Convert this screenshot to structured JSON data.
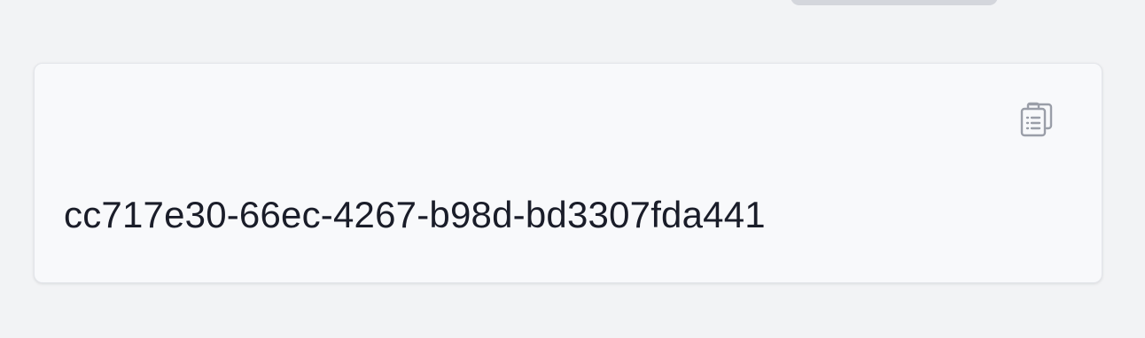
{
  "card": {
    "value": "cc717e30-66ec-4267-b98d-bd3307fda441",
    "copy_icon": "clipboard-icon"
  },
  "colors": {
    "background": "#f2f3f5",
    "card_background": "#f8f9fb",
    "text": "#1a1d29",
    "icon": "#9a9ea8"
  }
}
